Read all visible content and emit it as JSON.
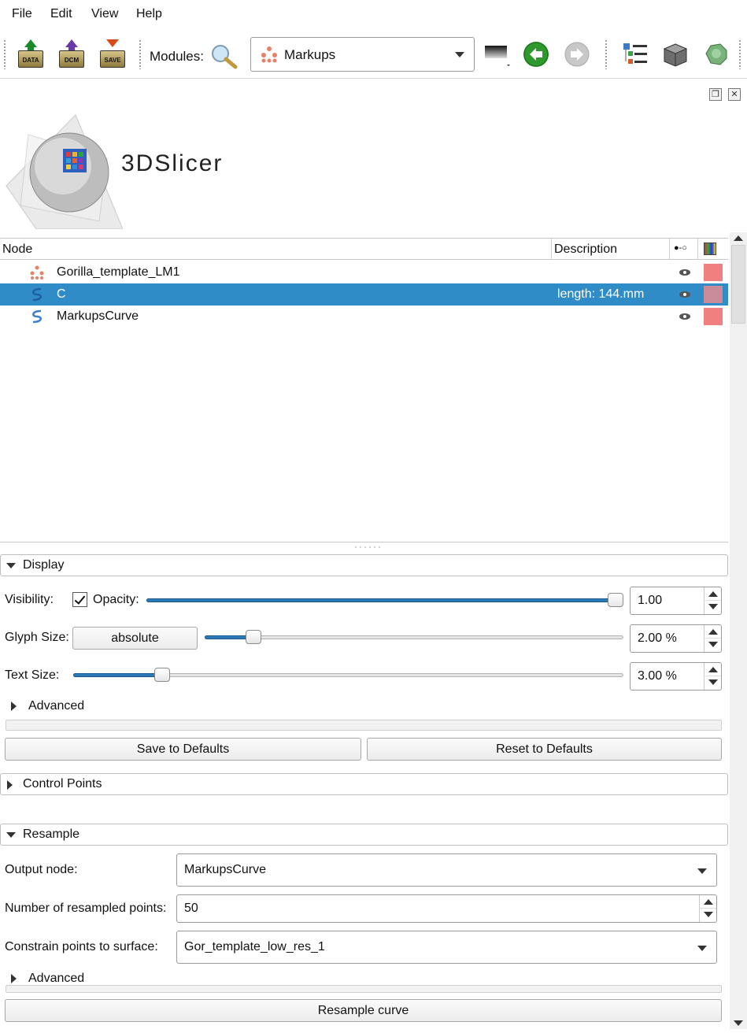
{
  "menu": [
    {
      "label": "File"
    },
    {
      "label": "Edit"
    },
    {
      "label": "View"
    },
    {
      "label": "Help"
    }
  ],
  "toolbar": {
    "data_label": "DATA",
    "dcm_label": "DCM",
    "save_label": "SAVE",
    "modules_label": "Modules:",
    "module_selected": "Markups"
  },
  "logo": {
    "text": "3DSlicer"
  },
  "tree": {
    "headers": {
      "node": "Node",
      "description": "Description"
    },
    "rows": [
      {
        "name": "Gorilla_template_LM1",
        "description": "",
        "icon": "markups-fiducial-icon",
        "color": "#f08080",
        "selected": false
      },
      {
        "name": "C",
        "description": "length: 144.mm",
        "icon": "markups-curve-icon",
        "color": "#c98a9a",
        "selected": true
      },
      {
        "name": "MarkupsCurve",
        "description": "",
        "icon": "markups-curve-icon",
        "color": "#f08080",
        "selected": false
      }
    ]
  },
  "display": {
    "title": "Display",
    "visibility_label": "Visibility:",
    "opacity_label": "Opacity:",
    "opacity_value": "1.00",
    "opacity_fraction": 1.0,
    "glyph_label": "Glyph Size:",
    "glyph_mode": "absolute",
    "glyph_value": "2.00 %",
    "glyph_fraction": 0.1,
    "text_label": "Text Size:",
    "text_value": "3.00 %",
    "text_fraction": 0.16,
    "advanced_label": "Advanced",
    "save_defaults": "Save to Defaults",
    "reset_defaults": "Reset to Defaults"
  },
  "control_points": {
    "title": "Control Points"
  },
  "resample": {
    "title": "Resample",
    "output_label": "Output node:",
    "output_value": "MarkupsCurve",
    "num_label": "Number of resampled points:",
    "num_value": "50",
    "constrain_label": "Constrain points to surface:",
    "constrain_value": "Gor_template_low_res_1",
    "advanced_label": "Advanced",
    "resample_button": "Resample curve"
  },
  "colors": {
    "selection": "#308cc6",
    "slider_fill": "#2a7ab7"
  }
}
